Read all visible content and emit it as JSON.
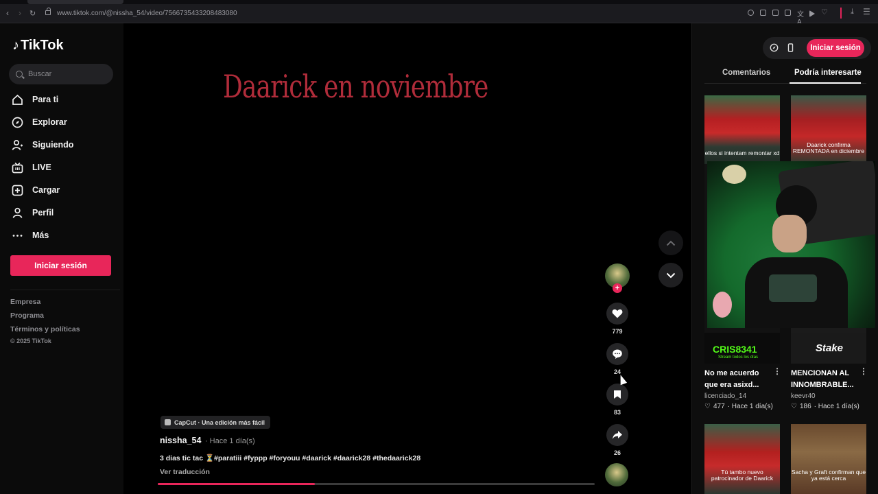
{
  "browser": {
    "url": "www.tiktok.com/@nissha_54/video/7566735433208483080",
    "accent": "#e3245a"
  },
  "sidebar": {
    "logo_text": "TikTok",
    "search_placeholder": "Buscar",
    "items": [
      {
        "label": "Para ti",
        "icon": "home-icon"
      },
      {
        "label": "Explorar",
        "icon": "compass-icon"
      },
      {
        "label": "Siguiendo",
        "icon": "person-follow-icon"
      },
      {
        "label": "LIVE",
        "icon": "live-tv-icon"
      },
      {
        "label": "Cargar",
        "icon": "upload-plus-icon"
      },
      {
        "label": "Perfil",
        "icon": "person-icon"
      },
      {
        "label": "Más",
        "icon": "more-dots-icon"
      }
    ],
    "login_label": "Iniciar sesión",
    "footer": [
      "Empresa",
      "Programa",
      "Términos y políticas"
    ],
    "copyright": "© 2025 TikTok"
  },
  "video": {
    "overlay_title": "Daarick en noviembre",
    "capcut_badge": "CapCut · Una edición más fácil",
    "author": "nissha_54",
    "time": "· Hace 1 día(s)",
    "caption": "3 dias tic tac ⏳#paratiii #fyppp #foryouu #daarick #daarick28 #thedaarick28",
    "translate": "Ver traducción",
    "progress_fraction": 0.36,
    "likes": "779",
    "comments": "24",
    "saves": "83",
    "shares": "26",
    "brand_color": "#e8265a"
  },
  "right": {
    "login_label": "Iniciar sesión",
    "tabs": [
      "Comentarios",
      "Podría interesarte"
    ],
    "active_tab": 1,
    "thumb_texts": {
      "t1": "ellos si intentam remontar xd",
      "t2": "Daarick confirma REMONTADA en diciembre",
      "kick": "CRIS8341",
      "kick_sub": "Stream todos los días",
      "stake": "Stake",
      "t5": "Tú tambo nuevo patrocinador de Daarick",
      "t6": "Sacha y Graft confirman que ya está cerca"
    },
    "cards": [
      {
        "title": "No me acuerdo que era asixd...",
        "user": "licenciado_14",
        "likes": "477",
        "time": "· Hace 1 día(s)"
      },
      {
        "title": "MENCIONAN AL INNOMBRABLE...",
        "user": "keevr40",
        "likes": "186",
        "time": "· Hace 1 día(s)"
      }
    ]
  }
}
